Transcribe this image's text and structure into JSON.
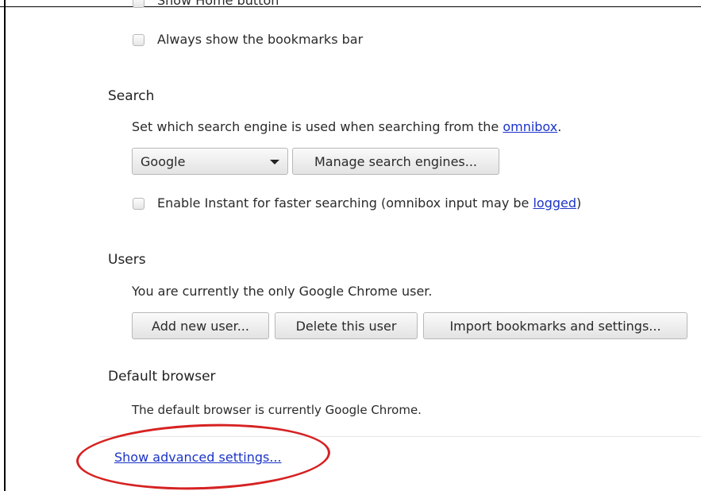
{
  "appearance": {
    "show_home_button_label": "Show Home button",
    "bookmarks_bar_label": "Always show the bookmarks bar"
  },
  "search": {
    "heading": "Search",
    "description_prefix": "Set which search engine is used when searching from the ",
    "description_link": "omnibox",
    "description_suffix": ".",
    "engine_selected": "Google",
    "manage_button": "Manage search engines...",
    "instant_prefix": "Enable Instant for faster searching (omnibox input may be ",
    "instant_link": "logged",
    "instant_suffix": ")"
  },
  "users": {
    "heading": "Users",
    "description": "You are currently the only Google Chrome user.",
    "add_button": "Add new user...",
    "delete_button": "Delete this user",
    "import_button": "Import bookmarks and settings..."
  },
  "default_browser": {
    "heading": "Default browser",
    "description": "The default browser is currently Google Chrome."
  },
  "advanced_link": "Show advanced settings...",
  "colors": {
    "link": "#1b33c8",
    "highlight_circle": "#d62222"
  }
}
